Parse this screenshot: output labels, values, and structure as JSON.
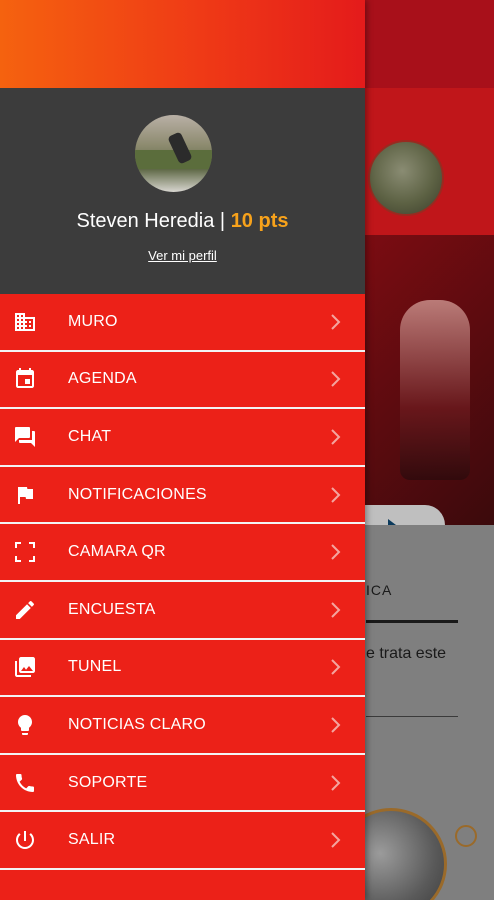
{
  "background": {
    "tab_label": "ICA",
    "body_text": "e trata este"
  },
  "drawer": {
    "profile": {
      "name": "Steven Heredia",
      "separator": "|",
      "points": "10 pts",
      "profile_link": "Ver mi perfil"
    },
    "menu": [
      {
        "label": "MURO",
        "icon": "building-icon"
      },
      {
        "label": "AGENDA",
        "icon": "calendar-icon"
      },
      {
        "label": "CHAT",
        "icon": "chat-icon"
      },
      {
        "label": "NOTIFICACIONES",
        "icon": "flag-icon"
      },
      {
        "label": "CAMARA QR",
        "icon": "scan-icon"
      },
      {
        "label": "ENCUESTA",
        "icon": "pencil-icon"
      },
      {
        "label": "TUNEL",
        "icon": "photo-library-icon"
      },
      {
        "label": "NOTICIAS CLARO",
        "icon": "lightbulb-icon"
      },
      {
        "label": "SOPORTE",
        "icon": "phone-icon"
      },
      {
        "label": "SALIR",
        "icon": "power-icon"
      }
    ]
  },
  "colors": {
    "drawer_red": "#ec2118",
    "profile_bg": "#3c3c3c",
    "points_orange": "#f7a21b",
    "gradient_start": "#f5620f",
    "gradient_end": "#e41b1b"
  }
}
